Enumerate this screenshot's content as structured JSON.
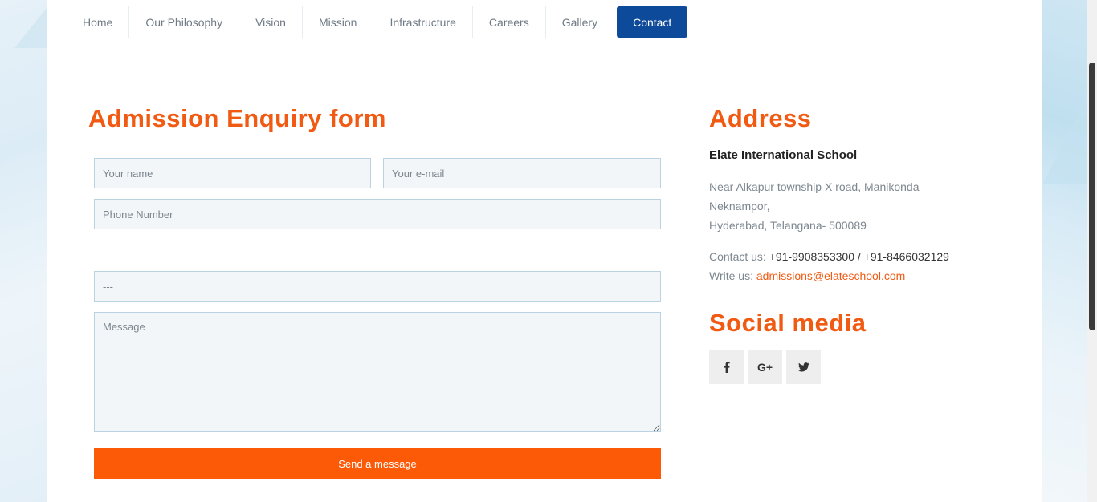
{
  "nav": {
    "items": [
      {
        "label": "Home"
      },
      {
        "label": "Our Philosophy"
      },
      {
        "label": "Vision"
      },
      {
        "label": "Mission"
      },
      {
        "label": "Infrastructure"
      },
      {
        "label": "Careers"
      },
      {
        "label": "Gallery"
      },
      {
        "label": "Contact"
      }
    ],
    "active": "Contact",
    "active_color": "#0d4a99"
  },
  "form": {
    "title": "Admission Enquiry form",
    "name_placeholder": "Your name",
    "email_placeholder": "Your e-mail",
    "phone_placeholder": "Phone Number",
    "select_placeholder": "---",
    "message_placeholder": "Message",
    "submit_label": "Send a message",
    "submit_color": "#fd5a08"
  },
  "address": {
    "title": "Address",
    "school_name": "Elate International School",
    "lines": [
      "Near Alkapur township X road, Manikonda",
      "Neknampor,",
      "Hyderabad, Telangana- 500089"
    ],
    "contact_label": "Contact us:",
    "contact_value": "+91-9908353300 / +91-8466032129",
    "write_label": "Write us:",
    "write_value": "admissions@elateschool.com"
  },
  "social": {
    "title": "Social media",
    "icons": [
      "facebook-icon",
      "google-plus-icon",
      "twitter-icon"
    ],
    "google_plus_glyph": "G+"
  },
  "colors": {
    "heading": "#f05a12",
    "field_bg": "#f2f6f9",
    "field_border": "#b9d3e3"
  }
}
